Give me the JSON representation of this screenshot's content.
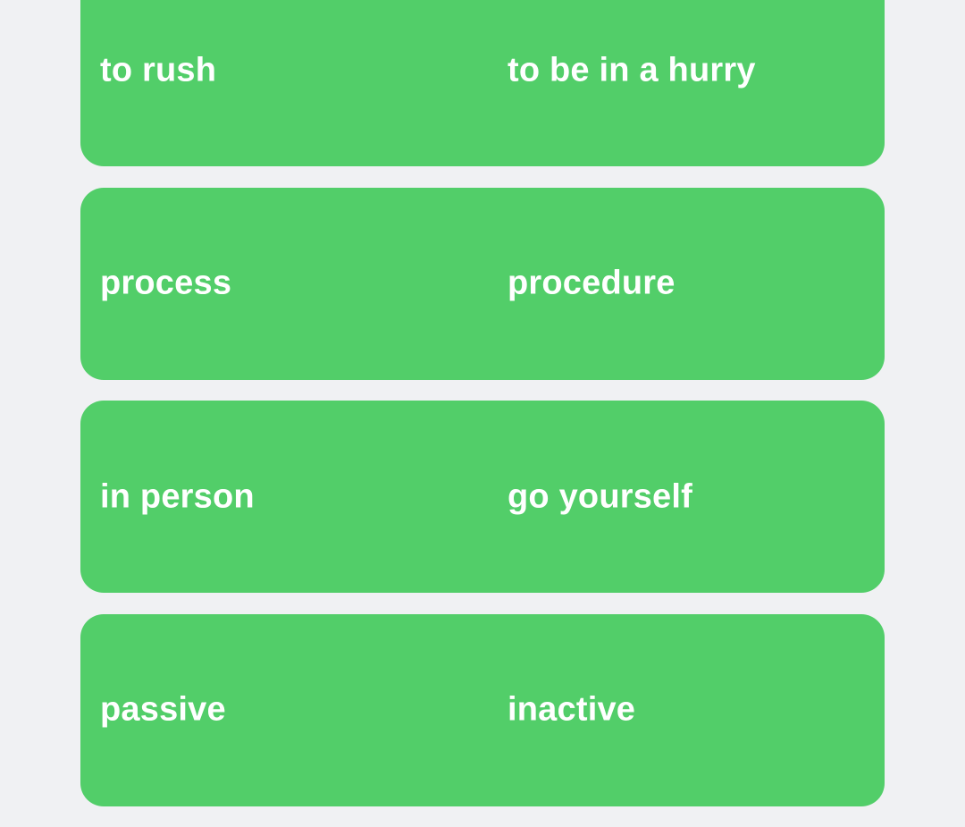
{
  "theme": {
    "background": "#f0f1f3",
    "card_color": "#52ce69",
    "text_color": "#ffffff"
  },
  "pairs": [
    {
      "term": "to rush",
      "match": "to be in a hurry"
    },
    {
      "term": "process",
      "match": "procedure"
    },
    {
      "term": "in person",
      "match": "go yourself"
    },
    {
      "term": "passive",
      "match": "inactive"
    }
  ]
}
